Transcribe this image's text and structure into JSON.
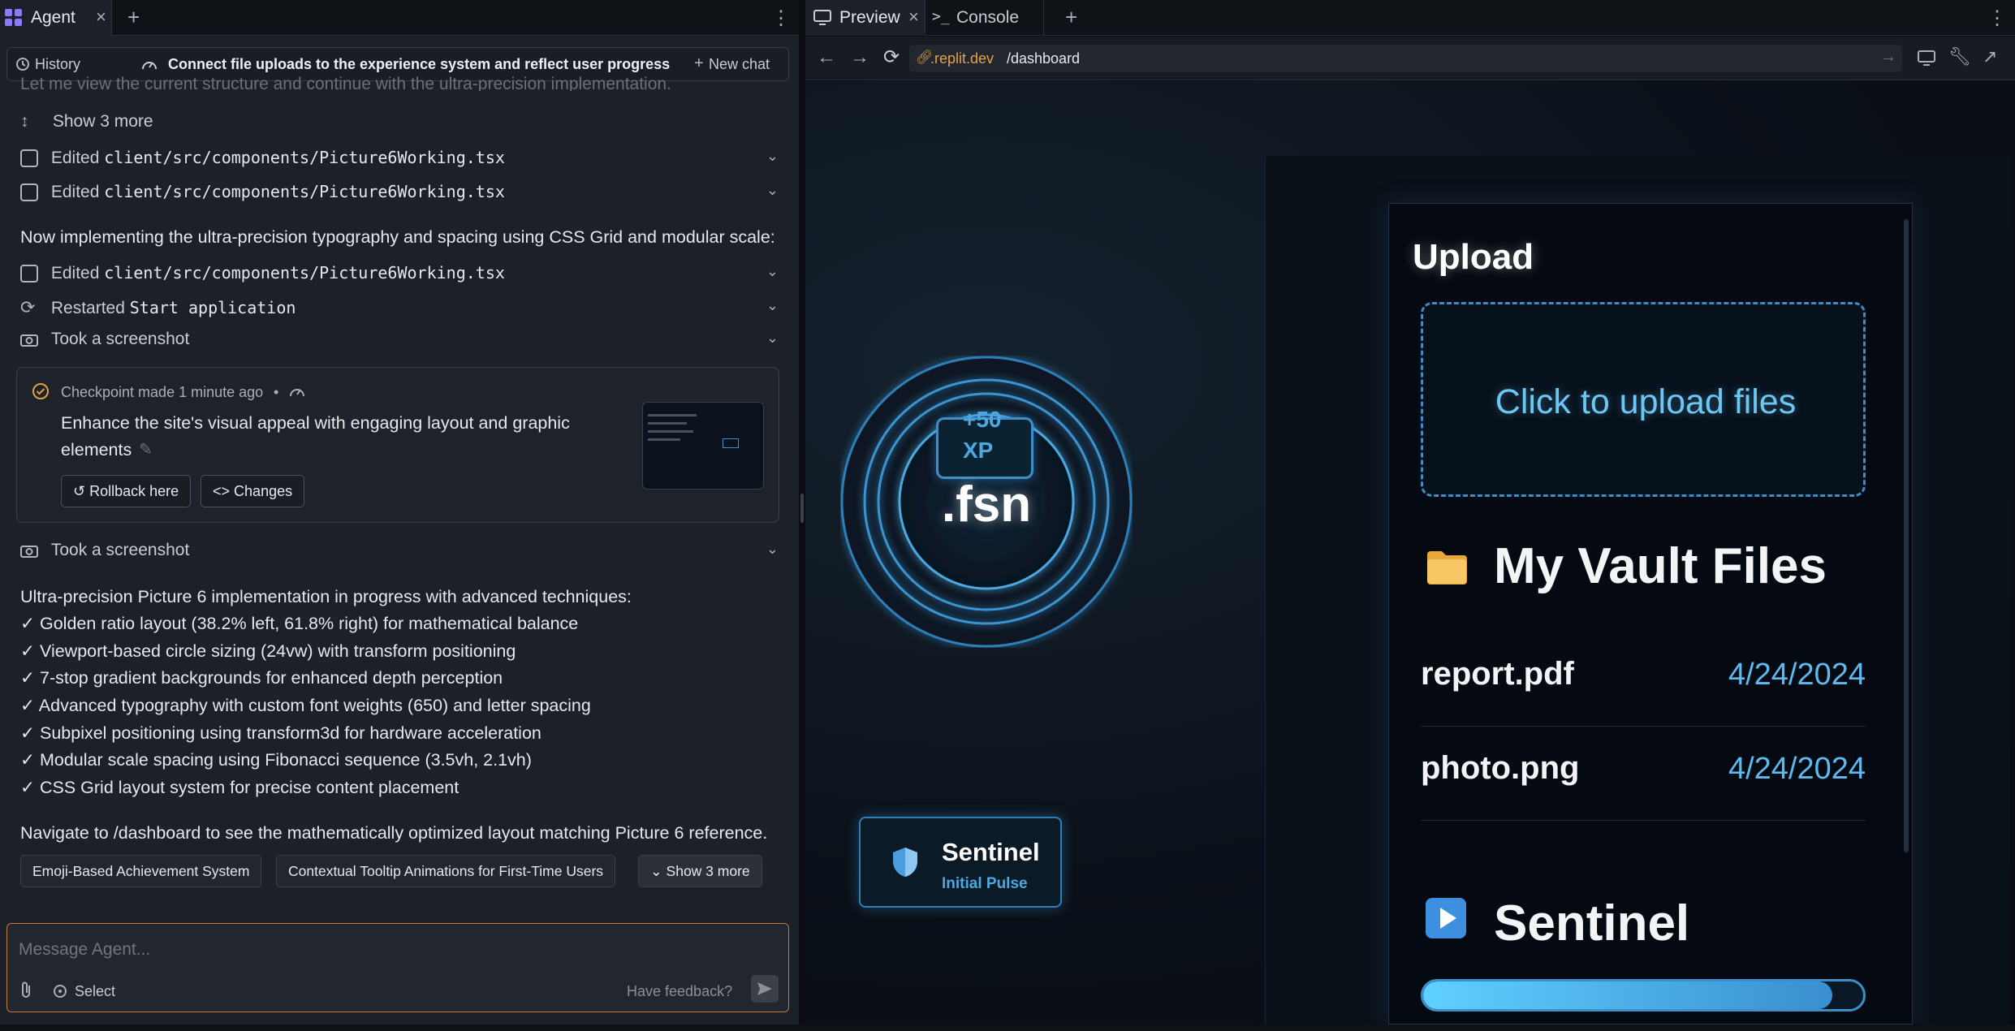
{
  "left_tabs": {
    "agent_label": "Agent",
    "close": "×",
    "add": "+",
    "more": "⋮"
  },
  "header": {
    "history_label": "History",
    "chat_title": "Connect file uploads to the experience system and reflect user progress",
    "new_chat_label": "New chat"
  },
  "chat": {
    "faded_line": "Let me view the current structure and continue with the ultra-precision implementation.",
    "show_more": "Show 3 more",
    "edit1_prefix": "Edited",
    "edit1_path": "client/src/components/Picture6Working.tsx",
    "edit2_prefix": "Edited",
    "edit2_path": "client/src/components/Picture6Working.tsx",
    "message1": "Now implementing the ultra-precision typography and spacing using CSS Grid and modular scale:",
    "edit3_prefix": "Edited",
    "edit3_path": "client/src/components/Picture6Working.tsx",
    "restart_prefix": "Restarted",
    "restart_target": "Start application",
    "screenshot1": "Took a screenshot",
    "checkpoint": {
      "status": "Checkpoint made 1 minute ago",
      "dot": "•",
      "description_line1": "Enhance the site's visual appeal with engaging layout and graphic",
      "description_line2": "elements",
      "rollback_label": "Rollback here",
      "changes_label": "Changes"
    },
    "screenshot2": "Took a screenshot",
    "summary_intro": "Ultra-precision Picture 6 implementation in progress with advanced techniques:",
    "bullets": [
      "✓ Golden ratio layout (38.2% left, 61.8% right) for mathematical balance",
      "✓ Viewport-based circle sizing (24vw) with transform positioning",
      "✓ 7-stop gradient backgrounds for enhanced depth perception",
      "✓ Advanced typography with custom font weights (650) and letter spacing",
      "✓ Subpixel positioning using transform3d for hardware acceleration",
      "✓ Modular scale spacing using Fibonacci sequence (3.5vh, 2.1vh)",
      "✓ CSS Grid layout system for precise content placement"
    ],
    "navigate_text": "Navigate to /dashboard to see the mathematically optimized layout matching Picture 6 reference.",
    "suggestions": [
      "Emoji-Based Achievement System",
      "Contextual Tooltip Animations for First-Time Users",
      "Show 3 more"
    ]
  },
  "composer": {
    "placeholder": "Message Agent...",
    "select_label": "Select",
    "feedback_label": "Have feedback?"
  },
  "right_tabs": {
    "preview_label": "Preview",
    "console_label": "Console",
    "close": "×",
    "add": "+",
    "more": "⋮"
  },
  "urlbar": {
    "url_domain": ".replit.dev",
    "url_path": "/dashboard"
  },
  "app": {
    "xp_line1": "+50",
    "xp_line2": "XP",
    "core_label": ".fsn",
    "badge_title": "Sentinel",
    "badge_subtitle": "Initial Pulse",
    "upload_title": "Upload",
    "dropzone_label": "Click to upload files",
    "vault_title": "My Vault Files",
    "files": [
      {
        "name": "report.pdf",
        "date": "4/24/2024"
      },
      {
        "name": "photo.png",
        "date": "4/24/2024"
      }
    ],
    "sentinel_title": "Sentinel",
    "progress_fraction": 0.93
  },
  "colors": {
    "accent_orange": "#c27c34",
    "cyan": "#6cc7f2",
    "agent_logo": "#8b7cf6"
  },
  "icons": [
    "agent-logo-icon",
    "history-icon",
    "gauge-icon",
    "plus-icon",
    "expand-icon",
    "edit-file-icon",
    "chevron-down-icon",
    "restart-icon",
    "camera-icon",
    "check-circle-icon",
    "pencil-icon",
    "rollback-icon",
    "code-icon",
    "paperclip-icon",
    "target-icon",
    "send-icon",
    "monitor-icon",
    "terminal-icon",
    "back-icon",
    "forward-icon",
    "reload-icon",
    "link-icon",
    "arrow-right-icon",
    "devices-icon",
    "wrench-icon",
    "external-link-icon",
    "folder-icon",
    "play-icon",
    "shield-icon"
  ]
}
